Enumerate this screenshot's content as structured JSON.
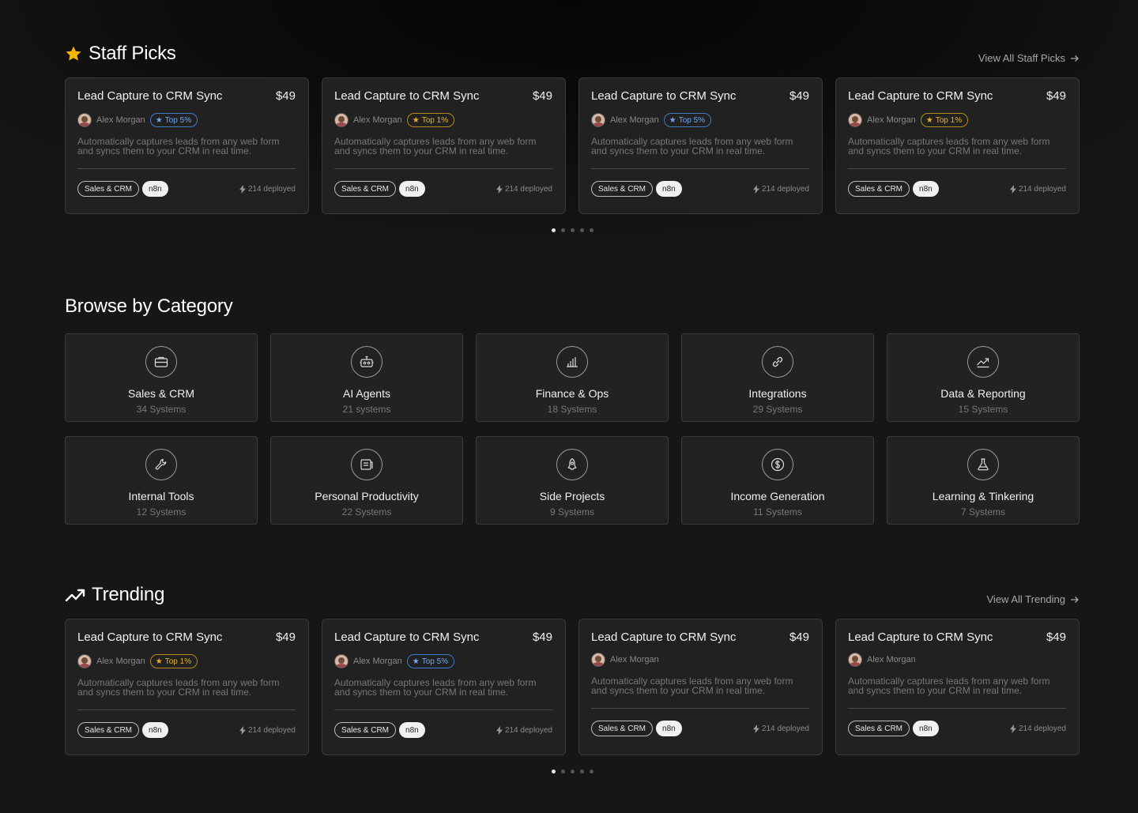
{
  "colors": {
    "accent_gold": "#f5b400",
    "badge_blue": "#6fa8f0",
    "badge_gold": "#e8b22a"
  },
  "staff_picks": {
    "title": "Staff Picks",
    "icon": "star-icon",
    "view_all": "View All Staff Picks",
    "cards": [
      {
        "title": "Lead Capture to CRM Sync",
        "price": "$49",
        "author": "Alex Morgan",
        "badge": "Top 5%",
        "badge_color": "blue",
        "desc": "Automatically captures leads from any web form and syncs them to your CRM in real time.",
        "tag1": "Sales & CRM",
        "tag2": "n8n",
        "deployed": "214 deployed"
      },
      {
        "title": "Lead Capture to CRM Sync",
        "price": "$49",
        "author": "Alex Morgan",
        "badge": "Top 1%",
        "badge_color": "gold",
        "desc": "Automatically captures leads from any web form and syncs them to your CRM in real time.",
        "tag1": "Sales & CRM",
        "tag2": "n8n",
        "deployed": "214 deployed"
      },
      {
        "title": "Lead Capture to CRM Sync",
        "price": "$49",
        "author": "Alex Morgan",
        "badge": "Top 5%",
        "badge_color": "blue",
        "desc": "Automatically captures leads from any web form and syncs them to your CRM in real time.",
        "tag1": "Sales & CRM",
        "tag2": "n8n",
        "deployed": "214 deployed"
      },
      {
        "title": "Lead Capture to CRM Sync",
        "price": "$49",
        "author": "Alex Morgan",
        "badge": "Top 1%",
        "badge_color": "gold",
        "desc": "Automatically captures leads from any web form and syncs them to your CRM in real time.",
        "tag1": "Sales & CRM",
        "tag2": "n8n",
        "deployed": "214 deployed"
      }
    ],
    "pagination": {
      "pages": 5,
      "active": 1
    }
  },
  "browse": {
    "title": "Browse by Category",
    "categories": [
      {
        "name": "Sales & CRM",
        "count": "34 Systems",
        "icon": "briefcase-icon"
      },
      {
        "name": "AI Agents",
        "count": "21 systems",
        "icon": "robot-icon"
      },
      {
        "name": "Finance & Ops",
        "count": "18 Systems",
        "icon": "bar-chart-icon"
      },
      {
        "name": "Integrations",
        "count": "29 Systems",
        "icon": "link-icon"
      },
      {
        "name": "Data & Reporting",
        "count": "15 Systems",
        "icon": "trend-line-icon"
      },
      {
        "name": "Internal Tools",
        "count": "12 Systems",
        "icon": "wrench-icon"
      },
      {
        "name": "Personal Productivity",
        "count": "22 Systems",
        "icon": "notes-icon"
      },
      {
        "name": "Side Projects",
        "count": "9 Systems",
        "icon": "rocket-icon"
      },
      {
        "name": "Income Generation",
        "count": "11 Systems",
        "icon": "dollar-coin-icon"
      },
      {
        "name": "Learning & Tinkering",
        "count": "7 Systems",
        "icon": "flask-icon"
      }
    ]
  },
  "trending": {
    "title": "Trending",
    "icon": "trending-up-icon",
    "view_all": "View All Trending",
    "cards": [
      {
        "title": "Lead Capture to CRM Sync",
        "price": "$49",
        "author": "Alex Morgan",
        "badge": "Top 1%",
        "badge_color": "gold",
        "desc": "Automatically captures leads from any web form and syncs them to your CRM in real time.",
        "tag1": "Sales & CRM",
        "tag2": "n8n",
        "deployed": "214 deployed"
      },
      {
        "title": "Lead Capture to CRM Sync",
        "price": "$49",
        "author": "Alex Morgan",
        "badge": "Top 5%",
        "badge_color": "blue",
        "desc": "Automatically captures leads from any web form and syncs them to your CRM in real time.",
        "tag1": "Sales & CRM",
        "tag2": "n8n",
        "deployed": "214 deployed"
      },
      {
        "title": "Lead Capture to CRM Sync",
        "price": "$49",
        "author": "Alex Morgan",
        "badge": "",
        "badge_color": "",
        "desc": "Automatically captures leads from any web form and syncs them to your CRM in real time.",
        "tag1": "Sales & CRM",
        "tag2": "n8n",
        "deployed": "214 deployed"
      },
      {
        "title": "Lead Capture to CRM Sync",
        "price": "$49",
        "author": "Alex Morgan",
        "badge": "",
        "badge_color": "",
        "desc": "Automatically captures leads from any web form and syncs them to your CRM in real time.",
        "tag1": "Sales & CRM",
        "tag2": "n8n",
        "deployed": "214 deployed"
      }
    ],
    "pagination": {
      "pages": 5,
      "active": 1
    }
  }
}
